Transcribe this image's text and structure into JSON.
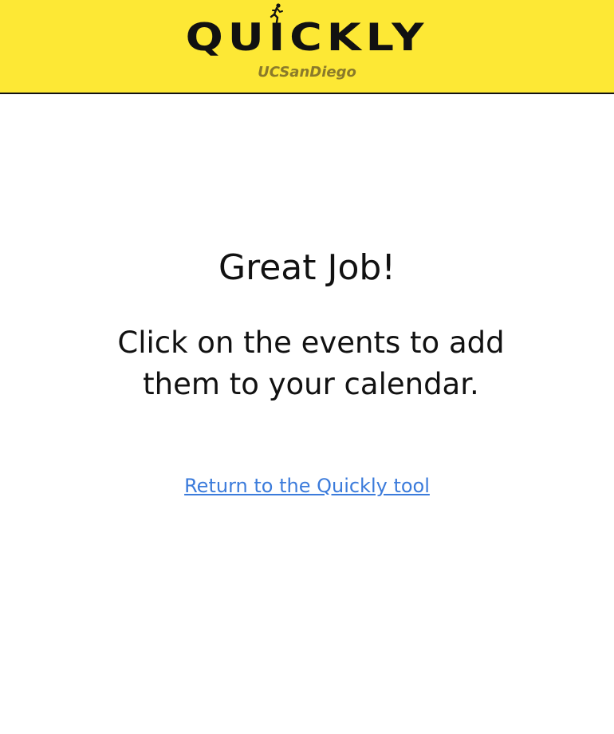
{
  "header": {
    "logo_text": "QUICKLY",
    "logo_icon": "runner-icon",
    "sub_logo": "UCSanDiego",
    "background_color": "#fde835"
  },
  "main": {
    "title": "Great Job!",
    "message": "Click on the events to add them to your calendar.",
    "return_link": "Return to the Quickly tool",
    "link_color": "#3b7bdb"
  }
}
